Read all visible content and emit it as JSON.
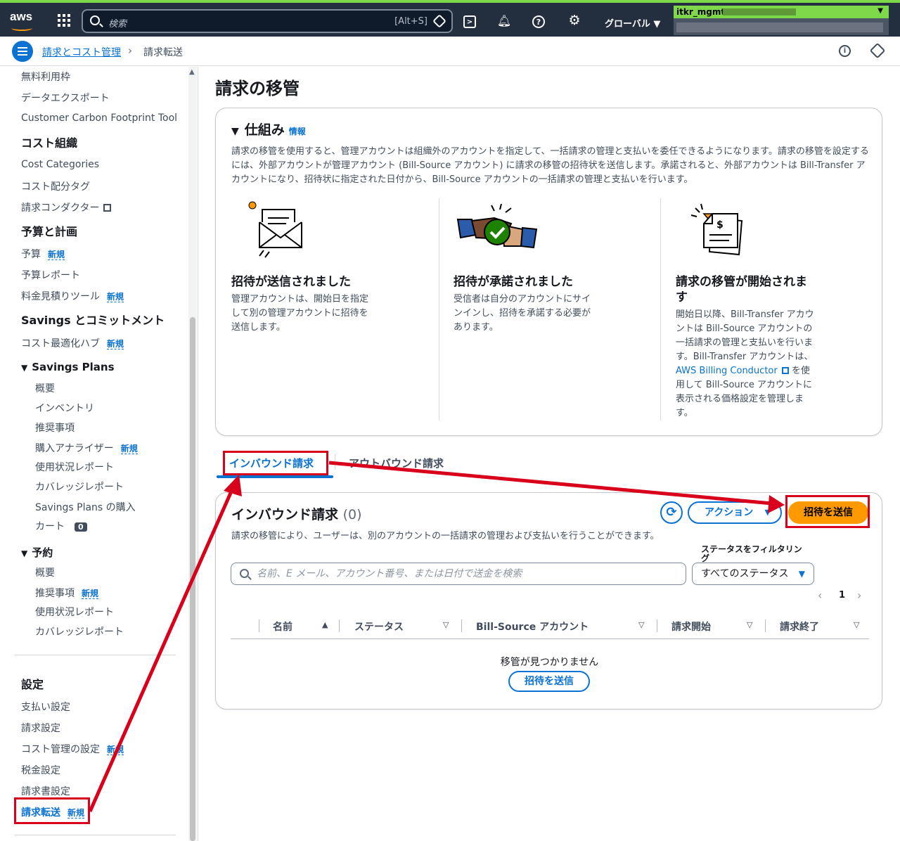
{
  "topbar": {
    "logo": "aws",
    "search_placeholder": "検索",
    "search_shortcut": "[Alt+S]",
    "region": "グローバル ▼",
    "account_name": "itkr_mgmt",
    "icons": [
      "grid-icon",
      "cloudshell-icon",
      "bell-icon",
      "help-icon",
      "gear-icon"
    ]
  },
  "breadcrumb": {
    "parent": "請求とコスト管理",
    "separator": "›",
    "current": "請求転送"
  },
  "sidebar": {
    "items_top": [
      "無料利用枠",
      "データエクスポート",
      "Customer Carbon Footprint Tool"
    ],
    "cost_org": {
      "heading": "コスト組織",
      "items": [
        "Cost Categories",
        "コスト配分タグ",
        "請求コンダクター"
      ]
    },
    "budget": {
      "heading": "予算と計画",
      "items": [
        "予算",
        "予算レポート",
        "料金見積りツール"
      ]
    },
    "savings": {
      "heading": "Savings とコミットメント",
      "item": "コスト最適化ハブ",
      "plans_heading": "Savings Plans",
      "plans_items": [
        "概要",
        "インベントリ",
        "推奨事項",
        "購入アナライザー",
        "使用状況レポート",
        "カバレッジレポート",
        "Savings Plans の購入",
        "カート"
      ],
      "cart_count": "0",
      "reserve_heading": "予約",
      "reserve_items": [
        "概要",
        "推奨事項",
        "使用状況レポート",
        "カバレッジレポート"
      ]
    },
    "settings": {
      "heading": "設定",
      "items": [
        "支払い設定",
        "請求設定",
        "コスト管理の設定",
        "税金設定",
        "請求書設定",
        "請求転送"
      ]
    },
    "new_badge": "新規",
    "triangle": "▼"
  },
  "main": {
    "title": "請求の移管",
    "how": {
      "heading": "仕組み",
      "info": "情報",
      "description": "請求の移管を使用すると、管理アカウントは組織外のアカウントを指定して、一括請求の管理と支払いを委任できるようになります。請求の移管を設定するには、外部アカウントが管理アカウント (Bill-Source アカウント) に請求の移管の招待状を送信します。承諾されると、外部アカウントは Bill-Transfer アカウントになり、招待状に指定された日付から、Bill-Source アカウントの一括請求の管理と支払いを行います。",
      "steps": [
        {
          "title": "招待が送信されました",
          "text": "管理アカウントは、開始日を指定して別の管理アカウントに招待を送信します。"
        },
        {
          "title": "招待が承諾されました",
          "text": "受信者は自分のアカウントにサインインし、招待を承諾する必要があります。"
        },
        {
          "title": "請求の移管が開始されます",
          "text_before": "開始日以降、Bill-Transfer アカウントは Bill-Source アカウントの一括請求の管理と支払いを行います。Bill-Transfer アカウントは、",
          "link": "AWS Billing Conductor",
          "text_after": " を使用して Bill-Source アカウントに表示される価格設定を管理します。"
        }
      ]
    },
    "tabs": {
      "inbound": "インバウンド請求",
      "outbound": "アウトバウンド請求"
    },
    "inbound": {
      "title": "インバウンド請求",
      "count": "(0)",
      "description": "請求の移管により、ユーザーは、別のアカウントの一括請求の管理および支払いを行うことができます。",
      "refresh": "⟳",
      "action": "アクション",
      "send": "招待を送信",
      "filter_label": "ステータスをフィルタリング",
      "search_placeholder": "名前、E メール、アカウント番号、または日付で送金を検索",
      "status_value": "すべてのステータス",
      "page": "1",
      "columns": [
        "名前",
        "ステータス",
        "Bill-Source アカウント",
        "請求開始",
        "請求終了"
      ],
      "empty": "移管が見つかりません",
      "empty_button": "招待を送信"
    }
  },
  "colors": {
    "accent": "#0972d3",
    "primary_button": "#ff9900",
    "annotation": "#d8001a",
    "topbar": "#232f3e"
  }
}
